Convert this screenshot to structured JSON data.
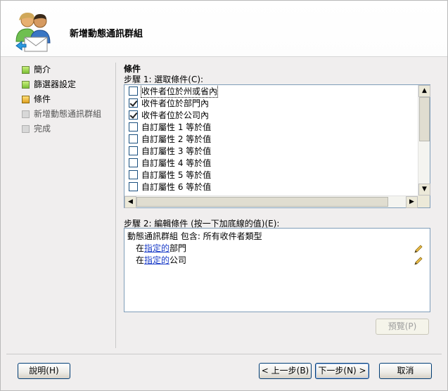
{
  "window": {
    "title": "新增動態通訊群組"
  },
  "nav": {
    "items": [
      {
        "label": "簡介",
        "state": "done"
      },
      {
        "label": "篩選器設定",
        "state": "done"
      },
      {
        "label": "條件",
        "state": "current"
      },
      {
        "label": "新增動態通訊群組",
        "state": "pending"
      },
      {
        "label": "完成",
        "state": "pending"
      }
    ]
  },
  "main": {
    "section_title": "條件",
    "step1_label": "步驟 1: 選取條件(C):",
    "conditions": [
      {
        "label": "收件者位於州或省內",
        "checked": false
      },
      {
        "label": "收件者位於部門內",
        "checked": true
      },
      {
        "label": "收件者位於公司內",
        "checked": true
      },
      {
        "label": "自訂屬性 1 等於值",
        "checked": false
      },
      {
        "label": "自訂屬性 2 等於值",
        "checked": false
      },
      {
        "label": "自訂屬性 3 等於值",
        "checked": false
      },
      {
        "label": "自訂屬性 4 等於值",
        "checked": false
      },
      {
        "label": "自訂屬性 5 等於值",
        "checked": false
      },
      {
        "label": "自訂屬性 6 等於值",
        "checked": false
      }
    ],
    "step2_label": "步驟 2: 編輯條件 (按一下加底線的值)(E):",
    "description": {
      "line1": "動態通訊群組 包含: 所有收件者類型",
      "line2_prefix": "在",
      "line2_link": "指定的",
      "line2_suffix": "部門",
      "line3_prefix": "在",
      "line3_link": "指定的",
      "line3_suffix": "公司"
    },
    "preview_label": "預覽(P)"
  },
  "footer": {
    "help_label": "說明(H)",
    "back_label": "< 上一步(B)",
    "next_label": "下一步(N) >",
    "cancel_label": "取消"
  },
  "colors": {
    "link": "#1a3cc8",
    "nav_done": "#7cc035",
    "nav_current": "#e0a020"
  },
  "icons": {
    "header": "user-group-envelope-icon",
    "edit": "pencil-icon"
  }
}
